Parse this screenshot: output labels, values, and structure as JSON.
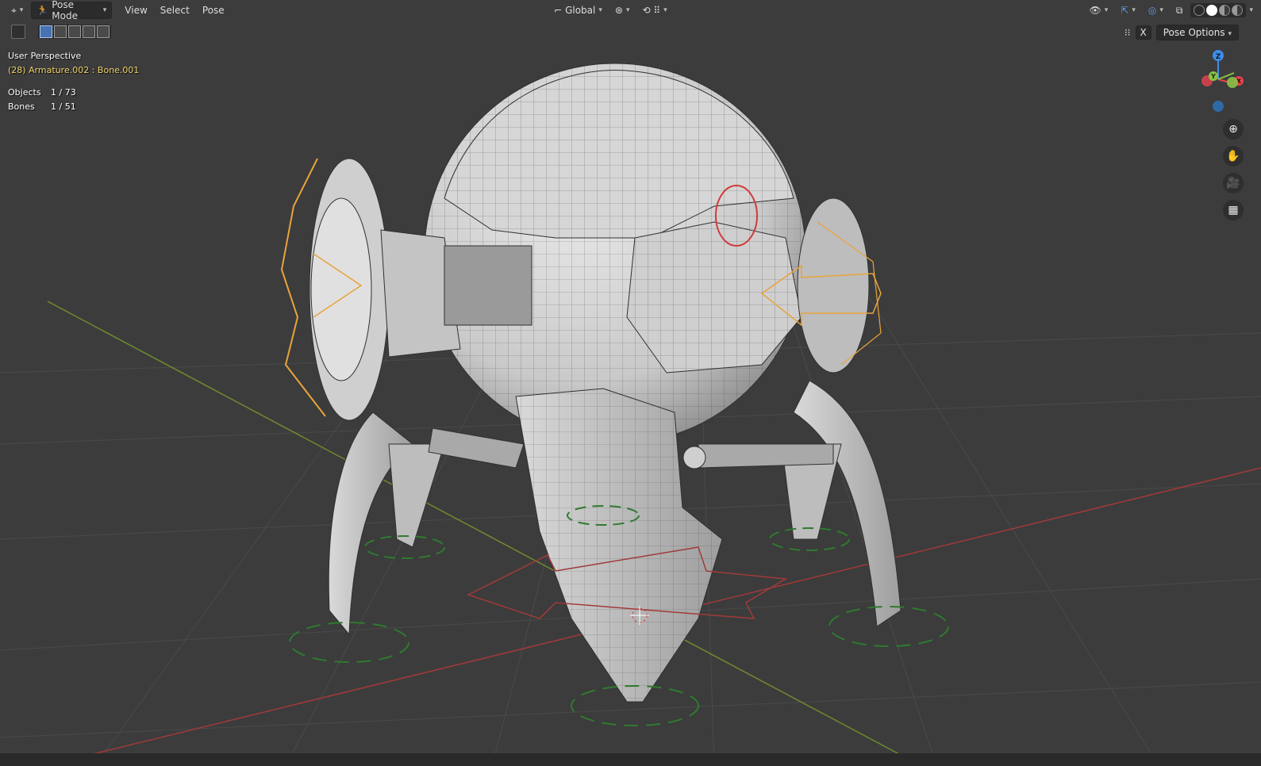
{
  "header": {
    "editor_icon": "editor-type-icon",
    "mode_label": "Pose Mode",
    "menus": [
      "View",
      "Select",
      "Pose"
    ],
    "orientation_label": "Global"
  },
  "toolbar_row2": {
    "pose_options_label": "Pose Options",
    "x_label": "X"
  },
  "overlay": {
    "view_name": "User Perspective",
    "active_info": "(28) Armature.002 : Bone.001",
    "stats": [
      {
        "label": "Objects",
        "value": "1 / 73"
      },
      {
        "label": "Bones",
        "value": "1 / 51"
      }
    ]
  },
  "gizmo": {
    "axes": [
      "Z",
      "Y",
      "X"
    ],
    "colors": {
      "x": "#e8434f",
      "y": "#8bc146",
      "z": "#3d8ee8"
    }
  },
  "colors": {
    "viewport_bg": "#3c3c3c",
    "selected_bone": "#e8a43a",
    "grid_x_axis": "#a23a3a",
    "grid_y_axis": "#6f8a2e"
  }
}
